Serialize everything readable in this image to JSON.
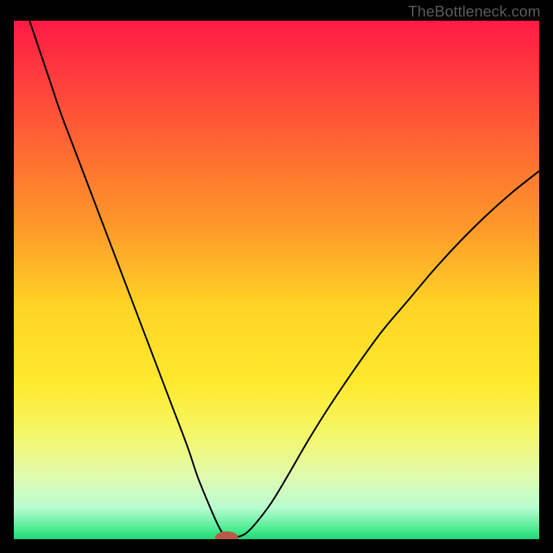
{
  "watermark": "TheBottleneck.com",
  "chart_data": {
    "type": "line",
    "title": "",
    "xlabel": "",
    "ylabel": "",
    "xlim": [
      0,
      100
    ],
    "ylim": [
      0,
      100
    ],
    "gradient_stops": [
      {
        "offset": 0.0,
        "color": "#ff1a45"
      },
      {
        "offset": 0.1,
        "color": "#ff3a3f"
      },
      {
        "offset": 0.25,
        "color": "#ff6a32"
      },
      {
        "offset": 0.4,
        "color": "#ff9a2a"
      },
      {
        "offset": 0.55,
        "color": "#ffd426"
      },
      {
        "offset": 0.7,
        "color": "#ffe92e"
      },
      {
        "offset": 0.8,
        "color": "#f4f76a"
      },
      {
        "offset": 0.88,
        "color": "#e0fbb0"
      },
      {
        "offset": 0.94,
        "color": "#b8fcd2"
      },
      {
        "offset": 0.985,
        "color": "#3fe98a"
      },
      {
        "offset": 1.0,
        "color": "#1fd676"
      }
    ],
    "series": [
      {
        "name": "bottleneck-curve",
        "color": "#000000",
        "x": [
          3,
          5,
          7,
          9,
          12,
          15,
          18,
          21,
          24,
          27,
          30,
          33,
          35,
          37,
          38.5,
          39.5,
          40.2,
          40.5,
          41,
          42,
          44,
          46,
          49,
          52,
          56,
          60,
          65,
          70,
          75,
          80,
          85,
          90,
          95,
          100
        ],
        "y": [
          100,
          94,
          88,
          82,
          74,
          66,
          58,
          50,
          42,
          34,
          26,
          18,
          12,
          7,
          3.5,
          1.5,
          0.5,
          0.3,
          0.3,
          0.3,
          1.0,
          3.0,
          7.0,
          12.0,
          19.0,
          25.5,
          33.0,
          40.0,
          46.0,
          52.0,
          57.5,
          62.5,
          67.0,
          71.0
        ]
      }
    ],
    "marker": {
      "name": "result-marker",
      "x": 40.5,
      "y": 0.3,
      "color": "#b85a4a",
      "rx": 2.2,
      "ry": 1.2
    }
  }
}
